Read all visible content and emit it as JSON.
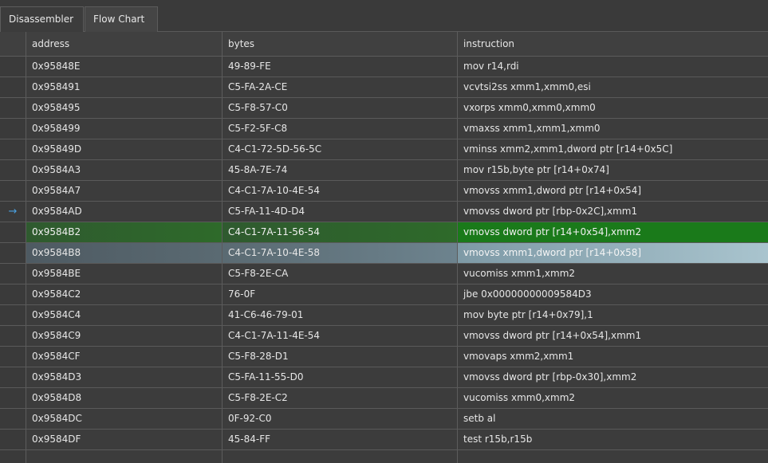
{
  "tabs": [
    {
      "label": "Disassembler",
      "active": true
    },
    {
      "label": "Flow Chart",
      "active": false
    }
  ],
  "columns": {
    "address": "address",
    "bytes": "bytes",
    "instruction": "instruction"
  },
  "current_marker": "→",
  "highlight_colors": {
    "breakpoint_green": "#1a7a1a",
    "selected_row": "#a9c4ce",
    "current_arrow": "#4aa0e0"
  },
  "rows": [
    {
      "address": "0x95848E",
      "bytes": "49-89-FE",
      "instruction": "mov  r14,rdi",
      "marker": "",
      "state": ""
    },
    {
      "address": "0x958491",
      "bytes": "C5-FA-2A-CE",
      "instruction": "vcvtsi2ss xmm1,xmm0,esi",
      "marker": "",
      "state": ""
    },
    {
      "address": "0x958495",
      "bytes": "C5-F8-57-C0",
      "instruction": "vxorps xmm0,xmm0,xmm0",
      "marker": "",
      "state": ""
    },
    {
      "address": "0x958499",
      "bytes": "C5-F2-5F-C8",
      "instruction": "vmaxss xmm1,xmm1,xmm0",
      "marker": "",
      "state": ""
    },
    {
      "address": "0x95849D",
      "bytes": "C4-C1-72-5D-56-5C",
      "instruction": "vminss xmm2,xmm1,dword ptr [r14+0x5C]",
      "marker": "",
      "state": ""
    },
    {
      "address": "0x9584A3",
      "bytes": "45-8A-7E-74",
      "instruction": "mov  r15b,byte ptr [r14+0x74]",
      "marker": "",
      "state": ""
    },
    {
      "address": "0x9584A7",
      "bytes": "C4-C1-7A-10-4E-54",
      "instruction": "vmovss xmm1,dword ptr [r14+0x54]",
      "marker": "",
      "state": ""
    },
    {
      "address": "0x9584AD",
      "bytes": "C5-FA-11-4D-D4",
      "instruction": "vmovss dword ptr [rbp-0x2C],xmm1",
      "marker": "→",
      "state": ""
    },
    {
      "address": "0x9584B2",
      "bytes": "C4-C1-7A-11-56-54",
      "instruction": "vmovss dword ptr [r14+0x54],xmm2",
      "marker": "",
      "state": "green"
    },
    {
      "address": "0x9584B8",
      "bytes": "C4-C1-7A-10-4E-58",
      "instruction": "vmovss xmm1,dword ptr [r14+0x58]",
      "marker": "",
      "state": "sel"
    },
    {
      "address": "0x9584BE",
      "bytes": "C5-F8-2E-CA",
      "instruction": "vucomiss xmm1,xmm2",
      "marker": "",
      "state": ""
    },
    {
      "address": "0x9584C2",
      "bytes": "76-0F",
      "instruction": "jbe  0x00000000009584D3",
      "marker": "",
      "state": ""
    },
    {
      "address": "0x9584C4",
      "bytes": "41-C6-46-79-01",
      "instruction": "mov  byte ptr [r14+0x79],1",
      "marker": "",
      "state": ""
    },
    {
      "address": "0x9584C9",
      "bytes": "C4-C1-7A-11-4E-54",
      "instruction": "vmovss dword ptr [r14+0x54],xmm1",
      "marker": "",
      "state": ""
    },
    {
      "address": "0x9584CF",
      "bytes": "C5-F8-28-D1",
      "instruction": "vmovaps xmm2,xmm1",
      "marker": "",
      "state": ""
    },
    {
      "address": "0x9584D3",
      "bytes": "C5-FA-11-55-D0",
      "instruction": "vmovss dword ptr [rbp-0x30],xmm2",
      "marker": "",
      "state": ""
    },
    {
      "address": "0x9584D8",
      "bytes": "C5-F8-2E-C2",
      "instruction": "vucomiss xmm0,xmm2",
      "marker": "",
      "state": ""
    },
    {
      "address": "0x9584DC",
      "bytes": "0F-92-C0",
      "instruction": "setb al",
      "marker": "",
      "state": ""
    },
    {
      "address": "0x9584DF",
      "bytes": "45-84-FF",
      "instruction": "test r15b,r15b",
      "marker": "",
      "state": ""
    }
  ]
}
